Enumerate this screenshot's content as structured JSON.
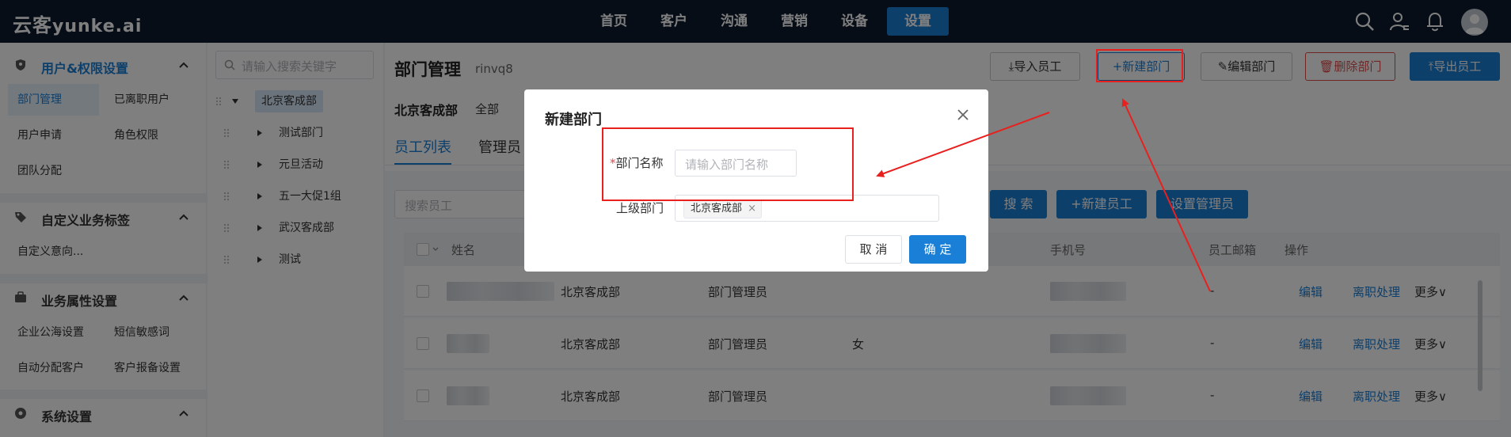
{
  "logo": {
    "text_main": "云客",
    "text_sub": "yunke.ai"
  },
  "nav": [
    "首页",
    "客户",
    "沟通",
    "营销",
    "设备",
    "设置"
  ],
  "nav_active_index": 5,
  "sidebar": {
    "group1": {
      "title": "用户&权限设置",
      "items": [
        "部门管理",
        "已离职用户",
        "用户申请",
        "角色权限",
        "团队分配"
      ]
    },
    "group2": {
      "title": "自定义业务标签",
      "items": [
        "自定义意向..."
      ]
    },
    "group3": {
      "title": "业务属性设置",
      "items": [
        "企业公海设置",
        "短信敏感词",
        "自动分配客户",
        "客户报备设置"
      ]
    },
    "group4": {
      "title": "系统设置"
    }
  },
  "tree": {
    "search_placeholder": "请输入搜索关键字",
    "root": "北京客成部",
    "children": [
      "测试部门",
      "元旦活动",
      "五一大促1组",
      "武汉客成部",
      "测试"
    ]
  },
  "main": {
    "title": "部门管理",
    "subtitle": "rinvq8",
    "buttons": {
      "import": "导入员工",
      "new_dept": "新建部门",
      "edit_dept": "编辑部门",
      "delete_dept": "删除部门",
      "export": "导出员工"
    },
    "breadcrumb_dept": "北京客成部",
    "breadcrumb_all": "全部",
    "tabs": [
      "员工列表",
      "管理员"
    ],
    "search_placeholder": "搜索员工",
    "search_btn": "搜 索",
    "new_employee_btn": "+新建员工",
    "set_admin_btn": "设置管理员",
    "columns": {
      "name": "姓名",
      "phone": "手机号",
      "email": "员工邮箱",
      "actions": "操作"
    },
    "rows": [
      {
        "dept": "北京客成部",
        "role": "部门管理员",
        "gender": "",
        "email": "-",
        "edit": "编辑",
        "leave": "离职处理",
        "more": "更多"
      },
      {
        "dept": "北京客成部",
        "role": "部门管理员",
        "gender": "女",
        "email": "-",
        "edit": "编辑",
        "leave": "离职处理",
        "more": "更多"
      },
      {
        "dept": "北京客成部",
        "role": "部门管理员",
        "gender": "",
        "email": "-",
        "edit": "编辑",
        "leave": "离职处理",
        "more": "更多"
      }
    ]
  },
  "modal": {
    "title": "新建部门",
    "name_label": "部门名称",
    "required_mark": "*",
    "name_placeholder": "请输入部门名称",
    "parent_label": "上级部门",
    "parent_tag": "北京客成部",
    "cancel": "取 消",
    "confirm": "确 定"
  },
  "colors": {
    "topbar": "#0d1b2e",
    "accent": "#1a7fd6",
    "danger": "#e04b4b",
    "annotation": "#e8211f"
  }
}
